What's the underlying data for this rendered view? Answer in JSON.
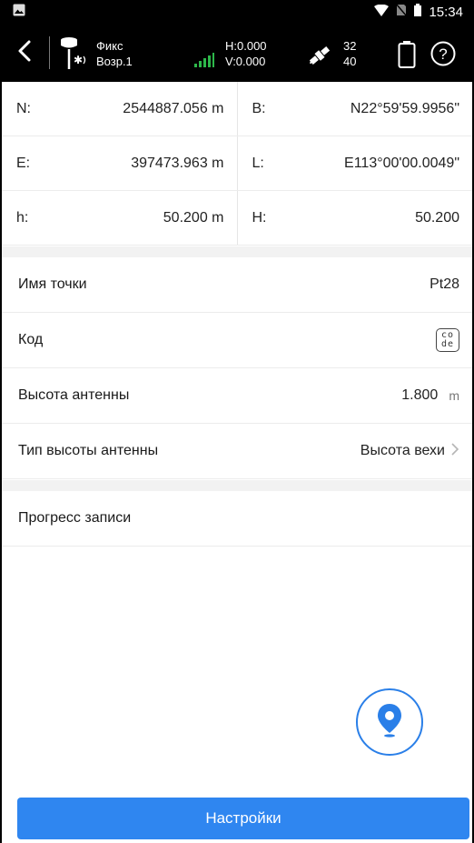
{
  "status_bar": {
    "time": "15:34",
    "icons": [
      "image-icon",
      "wifi-icon",
      "no-sim-icon",
      "battery-status-icon"
    ]
  },
  "top_bar": {
    "back_icon": "chevron-left-icon",
    "fix_status": "Фикс",
    "age": "Возр.1",
    "h_precision": "H:0.000",
    "v_precision": "V:0.000",
    "sat_used": "32",
    "sat_visible": "40",
    "help_icon": "help-circle-icon"
  },
  "coordinates": {
    "n_label": "N:",
    "n_value": "2544887.056 m",
    "b_label": "B:",
    "b_value": "N22°59'59.9956\"",
    "e_label": "E:",
    "e_value": "397473.963 m",
    "l_label": "L:",
    "l_value": "E113°00'00.0049\"",
    "h_label": "h:",
    "h_value": "50.200 m",
    "H_label": "H:",
    "H_value": "50.200"
  },
  "form": {
    "point_name_label": "Имя точки",
    "point_name_value": "Pt28",
    "code_label": "Код",
    "code_icon_text_top": "co",
    "code_icon_text_bottom": "de",
    "antenna_height_label": "Высота антенны",
    "antenna_height_value": "1.800",
    "antenna_height_unit": "m",
    "antenna_type_label": "Тип высоты антенны",
    "antenna_type_value": "Высота вехи"
  },
  "progress": {
    "label": "Прогресс записи"
  },
  "actions": {
    "settings_label": "Настройки"
  },
  "colors": {
    "accent": "#2f86f0",
    "bar_background": "#000000",
    "signal": "#2db84a"
  }
}
